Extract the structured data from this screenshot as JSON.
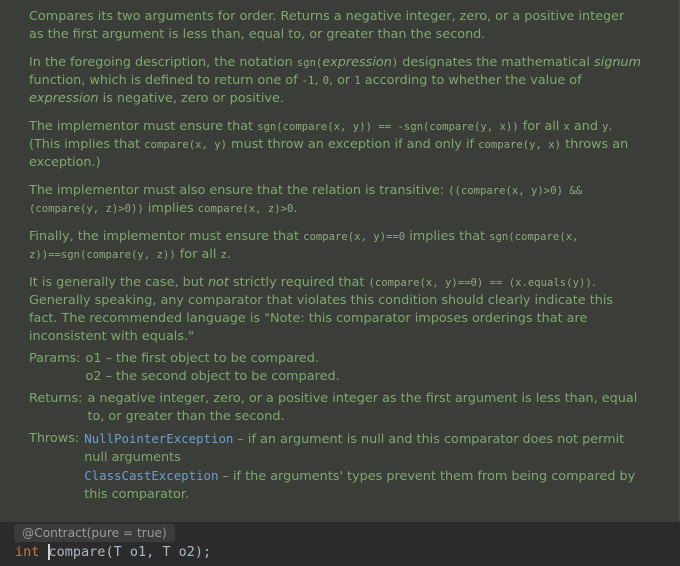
{
  "doc": {
    "p1": "Compares its two arguments for order. Returns a negative integer, zero, or a positive integer as the first argument is less than, equal to, or greater than the second.",
    "p2": {
      "t1": "In the foregoing description, the notation ",
      "c1": "sgn(",
      "i1": "expression",
      "c2": ")",
      "t2": " designates the mathematical ",
      "i2": "signum",
      "t3": " function, which is defined to return one of ",
      "c3": "-1",
      "t4": ", ",
      "c4": "0",
      "t5": ", or ",
      "c5": "1",
      "t6": " according to whether the value of ",
      "i3": "expression",
      "t7": " is negative, zero or positive."
    },
    "p3": {
      "t1": "The implementor must ensure that ",
      "c1": "sgn(compare(x, y)) == -sgn(compare(y, x))",
      "t2": " for all ",
      "c2": "x",
      "t3": " and ",
      "c3": "y",
      "t4": ". (This implies that ",
      "c4": "compare(x, y)",
      "t5": " must throw an exception if and only if ",
      "c5": "compare(y, x)",
      "t6": " throws an exception.)"
    },
    "p4": {
      "t1": "The implementor must also ensure that the relation is transitive: ",
      "c1": "((compare(x, y)>0) && (compare(y, z)>0))",
      "t2": " implies ",
      "c2": "compare(x, z)>0",
      "t3": "."
    },
    "p5": {
      "t1": "Finally, the implementor must ensure that ",
      "c1": "compare(x, y)==0",
      "t2": " implies that ",
      "c2": "sgn(compare(x, z))==sgn(compare(y, z))",
      "t3": " for all ",
      "c3": "z",
      "t4": "."
    },
    "p6": {
      "t1": "It is generally the case, but ",
      "i1": "not",
      "t2": " strictly required that ",
      "c1": "(compare(x, y)==0) == (x.equals(y))",
      "t3": ". Generally speaking, any comparator that violates this condition should clearly indicate this fact. The recommended language is \"Note: this comparator imposes orderings that are inconsistent with equals.\""
    },
    "params": {
      "label": "Params:",
      "o1": "o1 – the first object to be compared.",
      "o2": "o2 – the second object to be compared."
    },
    "returns": {
      "label": "Returns:",
      "text": "a negative integer, zero, or a positive integer as the first argument is less than, equal to, or greater than the second."
    },
    "throws": {
      "label": "Throws:",
      "e1": "NullPointerException",
      "e1_text": " – if an argument is null and this comparator does not permit null arguments",
      "e2": "ClassCastException",
      "e2_text": " – if the arguments' types prevent them from being compared by this comparator."
    }
  },
  "annotation": "@Contract(pure = true)",
  "code": {
    "kw_int": "int ",
    "name_first": "c",
    "name_rest": "ompare",
    "open": "(",
    "t1": "T",
    "o1": " o1, ",
    "t2": "T",
    "o2": " o2);"
  },
  "colors": {
    "doc_bg": "#3b3d38",
    "doc_text": "#7fa86f",
    "link": "#6a9fd1",
    "editor_bg": "#2b2b2b",
    "keyword": "#cc7832"
  }
}
